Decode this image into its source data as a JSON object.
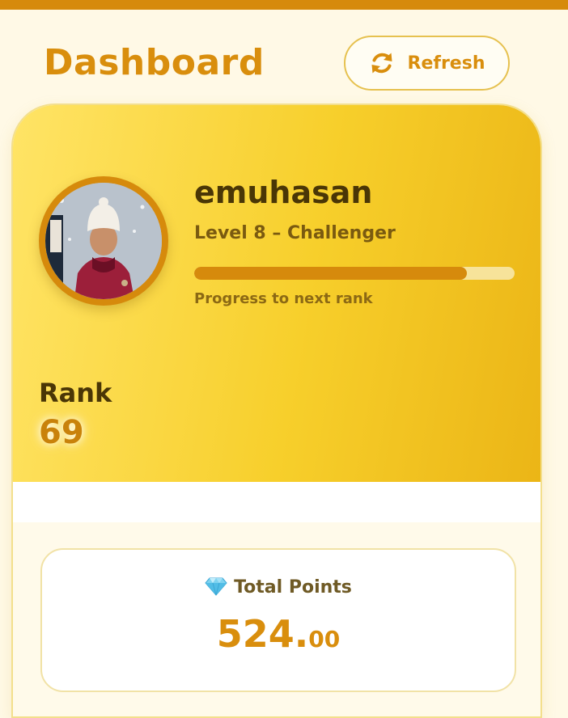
{
  "header": {
    "title": "Dashboard",
    "refresh_label": "Refresh",
    "refresh_icon": "refresh-icon"
  },
  "profile": {
    "username": "emuhasan",
    "level_text": "Level 8 – Challenger",
    "progress_fraction": 0.85,
    "progress_caption": "Progress to next rank",
    "avatar_icon": "user-avatar-photo"
  },
  "rank": {
    "label": "Rank",
    "value": "69"
  },
  "points": {
    "icon": "gem-icon",
    "label": "Total Points",
    "integer_part": "524.",
    "decimal_part": "00"
  },
  "colors": {
    "accent": "#d98e0d",
    "accent_dark": "#d68a0c",
    "hero_light": "#ffe466",
    "hero_dark": "#ebb516",
    "page_background": "#fff9e6",
    "text_dark": "#4a3606"
  }
}
